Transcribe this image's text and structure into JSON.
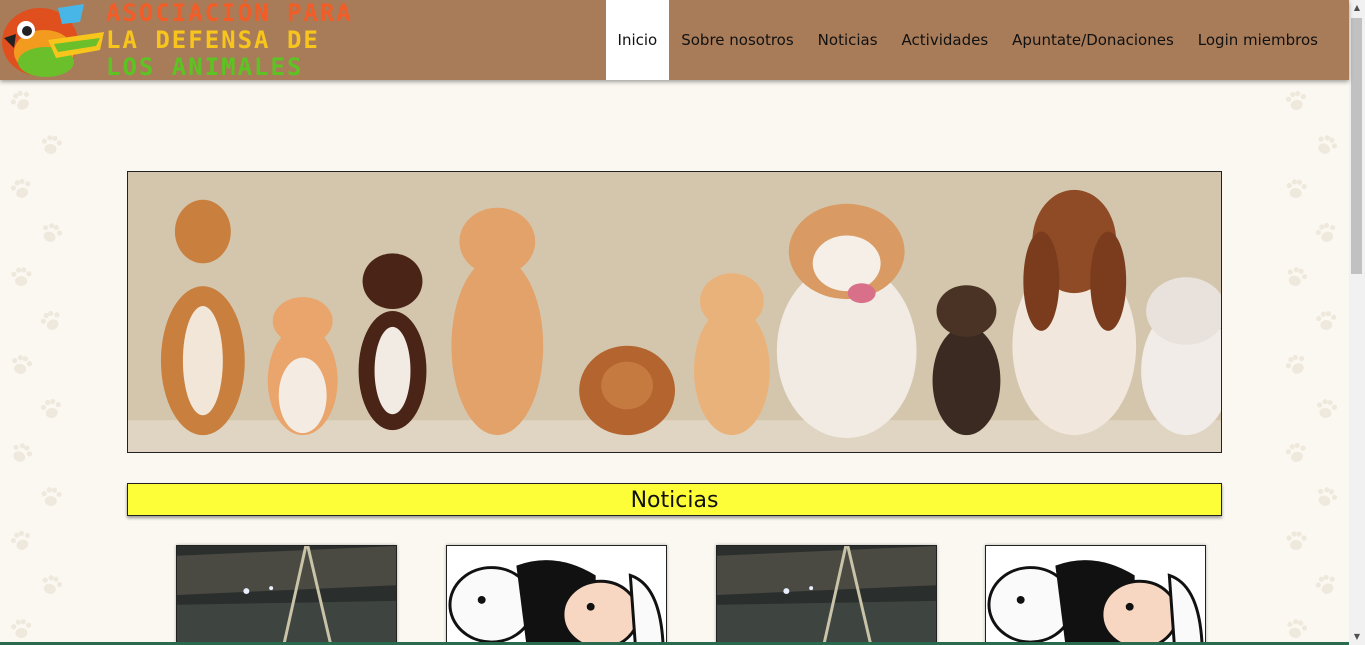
{
  "header": {
    "logo": {
      "line1": "ASOCIACIÓN PARA",
      "line2": "LA DEFENSA DE",
      "line3": "LOS ANIMALES",
      "icon": "bird-logo-icon"
    },
    "nav": [
      {
        "label": "Inicio",
        "active": true
      },
      {
        "label": "Sobre nosotros",
        "active": false
      },
      {
        "label": "Noticias",
        "active": false
      },
      {
        "label": "Actividades",
        "active": false
      },
      {
        "label": "Apuntate/Donaciones",
        "active": false
      },
      {
        "label": "Login miembros",
        "active": false
      }
    ]
  },
  "hero": {
    "image": "cats-and-dogs-banner"
  },
  "news": {
    "title": "Noticias",
    "cards": [
      {
        "image": "farm-barn-photo"
      },
      {
        "image": "cow-and-pig-cartoon"
      },
      {
        "image": "farm-barn-photo"
      },
      {
        "image": "cow-and-pig-cartoon"
      }
    ]
  },
  "colors": {
    "header_bg": "#a97c59",
    "news_bar_bg": "#fdfd38",
    "logo_orange": "#f25c26",
    "logo_yellow": "#f7c51c",
    "logo_green": "#5cc322"
  }
}
